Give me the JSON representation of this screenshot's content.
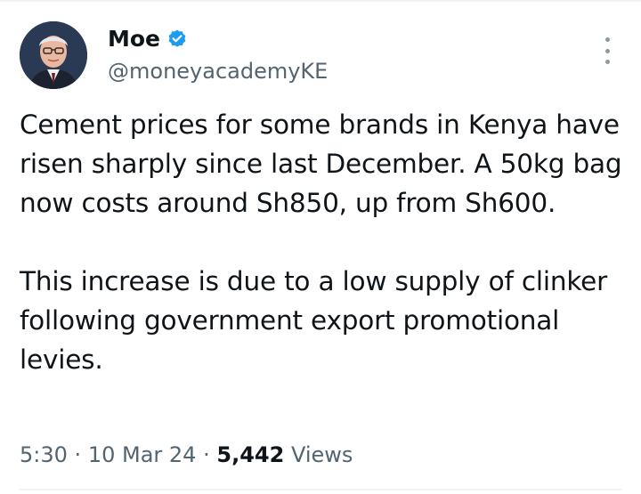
{
  "author": {
    "display_name": "Moe",
    "handle": "@moneyacademyKE",
    "verified": true,
    "avatar_icon": "profile-photo"
  },
  "tweet": {
    "paragraphs": [
      "Cement prices for some brands in Kenya have risen sharply since last December. A 50kg bag now costs around Sh850, up from Sh600.",
      "This increase is due to a low supply of clinker following government export promotional levies."
    ]
  },
  "meta": {
    "time": "5:30",
    "separator": "·",
    "date": "10 Mar 24",
    "views_count": "5,442",
    "views_label": "Views"
  },
  "colors": {
    "text": "#0f1419",
    "secondary": "#536471",
    "verified_badge": "#1d9bf0",
    "divider": "#eff3f4"
  }
}
